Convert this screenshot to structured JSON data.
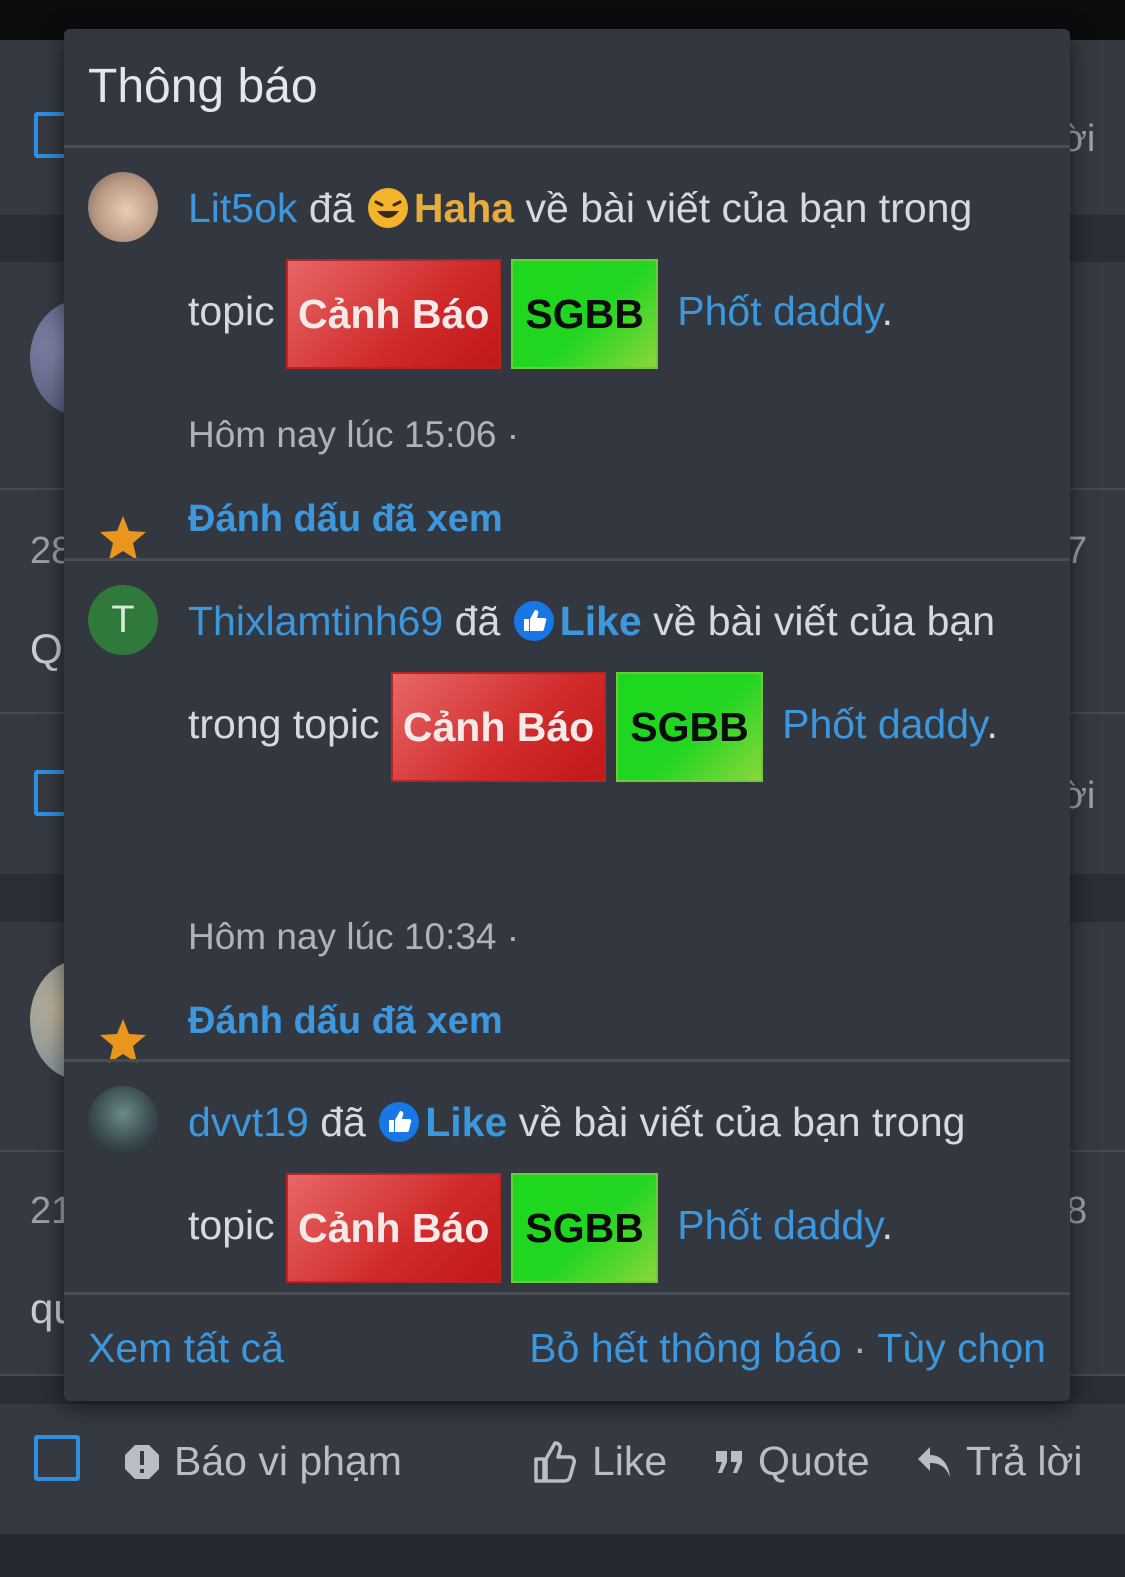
{
  "popup": {
    "title": "Thông báo",
    "notifications": [
      {
        "user": "Lit5ok",
        "verb": "đã",
        "reaction_icon": "haha-emoji-icon",
        "reaction": "Haha",
        "text": "về bài viết của bạn trong topic",
        "tag1": "Cảnh Báo",
        "tag2": "SGBB",
        "topic": "Phốt daddy",
        "period": ".",
        "time": "Hôm nay lúc 15:06 ·",
        "mark_read": "Đánh dấu đã xem",
        "avatar_letter": ""
      },
      {
        "user": "Thixlamtinh69",
        "verb": "đã",
        "reaction_icon": "like-thumb-icon",
        "reaction": "Like",
        "text": "về bài viết của bạn trong topic",
        "tag1": "Cảnh Báo",
        "tag2": "SGBB",
        "topic": "Phốt daddy",
        "period": ".",
        "time": "Hôm nay lúc 10:34 ·",
        "mark_read": "Đánh dấu đã xem",
        "avatar_letter": "T"
      },
      {
        "user": "dvvt19",
        "verb": "đã",
        "reaction_icon": "like-thumb-icon",
        "reaction": "Like",
        "text": "về bài viết của bạn trong topic",
        "tag1": "Cảnh Báo",
        "tag2": "SGBB",
        "topic": "Phốt daddy",
        "period": ".",
        "avatar_letter": ""
      }
    ],
    "footer": {
      "view_all": "Xem tất cả",
      "dismiss_all": "Bỏ hết thông báo",
      "separator": "·",
      "options": "Tùy chọn"
    }
  },
  "background": {
    "fragments": [
      "ời",
      "28",
      "Q",
      "ời",
      "7",
      "21",
      "8",
      "qu"
    ],
    "actions": {
      "report": "Báo vi phạm",
      "like": "Like",
      "quote": "Quote",
      "reply": "Trả lời"
    }
  },
  "colors": {
    "link": "#3d97dd",
    "haha": "#e6ac3c",
    "tag_red": "#d02a2a",
    "tag_green": "#22d622",
    "star": "#e8961e",
    "popup_bg": "#33373f",
    "page_bg": "#2a2e35"
  }
}
